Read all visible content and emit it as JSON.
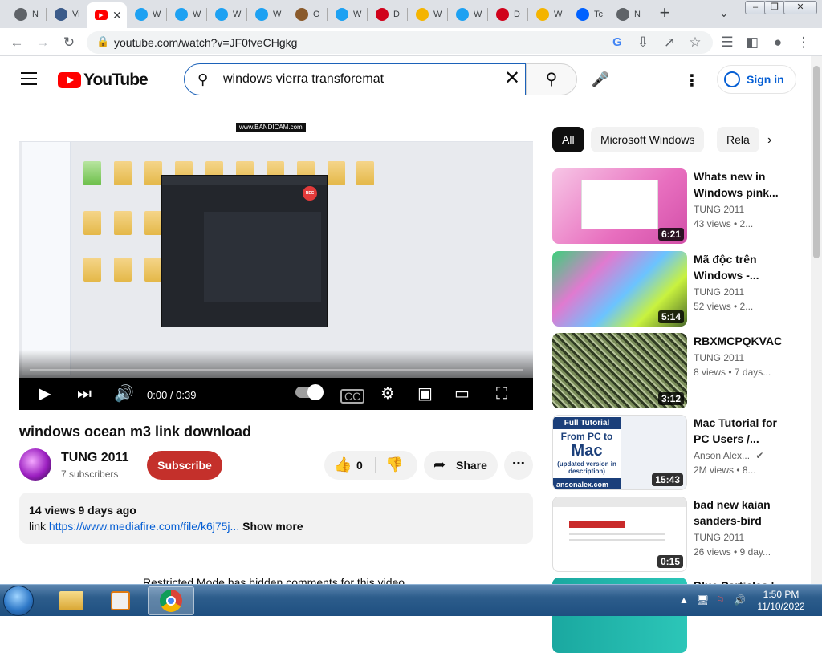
{
  "browser": {
    "tabs": [
      {
        "title": "N",
        "fav_color": "#5f6368",
        "fav": "github"
      },
      {
        "title": "Vi",
        "fav_color": "#3b5b8a",
        "fav": "site"
      },
      {
        "title": "",
        "fav_color": "#ff0000",
        "fav": "youtube",
        "active": true
      },
      {
        "title": "W",
        "fav_color": "#1da1f2",
        "fav": "edge"
      },
      {
        "title": "W",
        "fav_color": "#1da1f2",
        "fav": "edge"
      },
      {
        "title": "W",
        "fav_color": "#1da1f2",
        "fav": "edge"
      },
      {
        "title": "W",
        "fav_color": "#1da1f2",
        "fav": "edge"
      },
      {
        "title": "O",
        "fav_color": "#8a5a2b",
        "fav": "avatar"
      },
      {
        "title": "W",
        "fav_color": "#1da1f2",
        "fav": "edge"
      },
      {
        "title": "D",
        "fav_color": "#d0021b",
        "fav": "mega"
      },
      {
        "title": "W",
        "fav_color": "#f4b400",
        "fav": "drive"
      },
      {
        "title": "W",
        "fav_color": "#1da1f2",
        "fav": "edge"
      },
      {
        "title": "D",
        "fav_color": "#d0021b",
        "fav": "mega"
      },
      {
        "title": "W",
        "fav_color": "#f4b400",
        "fav": "drive"
      },
      {
        "title": "Tc",
        "fav_color": "#0061ff",
        "fav": "dropbox"
      },
      {
        "title": "N",
        "fav_color": "#5f6368",
        "fav": "github"
      }
    ],
    "url": "youtube.com/watch?v=JF0fveCHgkg"
  },
  "yt": {
    "logo_text": "YouTube",
    "search_value": "windows vierra transforemat",
    "signin_label": "Sign in"
  },
  "video": {
    "title": "windows ocean m3 link download",
    "time": "0:00 / 0:39",
    "watermark": "www.BANDICAM.com",
    "channel": "TUNG 2011",
    "subscribers": "7 subscribers",
    "subscribe_label": "Subscribe",
    "likes": "0",
    "share_label": "Share",
    "description": {
      "stats": "14 views  9 days ago",
      "prefix": "link ",
      "link": "https://www.mediafire.com/file/k6j75j...",
      "show_more": "Show more"
    },
    "restricted": "Restricted Mode has hidden comments for this video."
  },
  "chips": [
    "All",
    "Microsoft Windows",
    "Rela"
  ],
  "recommendations": [
    {
      "title": "Whats new in Windows pink...",
      "channel": "TUNG 2011",
      "meta": "43 views  • 2...",
      "duration": "6:21",
      "thumb": "pink"
    },
    {
      "title": "Mã độc trên Windows -...",
      "channel": "TUNG 2011",
      "meta": "52 views  • 2...",
      "duration": "5:14",
      "thumb": "glitch"
    },
    {
      "title": "RBXMCPQKVAC",
      "channel": "TUNG 2011",
      "meta": "8 views  • 7 days...",
      "duration": "3:12",
      "thumb": "noise"
    },
    {
      "title": "Mac Tutorial for PC Users /...",
      "channel": "Anson Alex...",
      "meta": "2M views  • 8...",
      "duration": "15:43",
      "thumb": "mac",
      "verified": true,
      "thumb_text": {
        "line1": "Full Tutorial",
        "line2": "From PC to",
        "line3": "Mac",
        "line4": "(updated version in description)",
        "badge": "ansonalex.com"
      }
    },
    {
      "title": "bad new kaian sanders-bird",
      "channel": "TUNG 2011",
      "meta": "26 views  • 9 day...",
      "duration": "0:15",
      "thumb": "white"
    },
    {
      "title": "Blue Particles |",
      "channel": "",
      "meta": "",
      "duration": "",
      "thumb": "teal"
    }
  ],
  "taskbar": {
    "time": "1:50 PM",
    "date": "11/10/2022"
  }
}
